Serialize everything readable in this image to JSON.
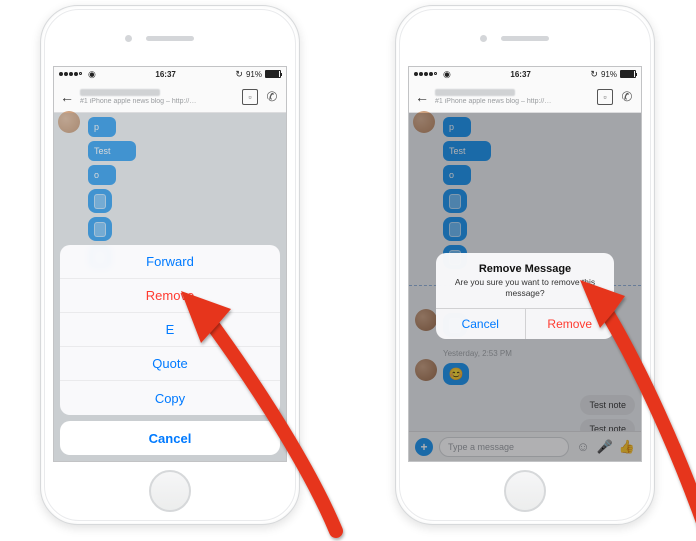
{
  "status_bar": {
    "time": "16:37",
    "battery": "91%"
  },
  "header": {
    "subtitle": "#1 iPhone apple news blog – http://…"
  },
  "messages": {
    "p": "p",
    "test": "Test",
    "o": "o"
  },
  "action_sheet": {
    "forward": "Forward",
    "remove": "Remove",
    "edit": "E",
    "quote": "Quote",
    "copy": "Copy",
    "cancel": "Cancel"
  },
  "alert": {
    "title": "Remove Message",
    "message": "Are you sure you want to remove this message?",
    "cancel": "Cancel",
    "remove": "Remove"
  },
  "right_chat": {
    "timestamp": "Yesterday, 2:53 PM",
    "note1": "Test note",
    "note2": "Test note"
  },
  "composer": {
    "placeholder": "Type a message"
  },
  "colors": {
    "blue": "#007aff",
    "red": "#ff3b30",
    "bubble": "#1a94f0"
  }
}
